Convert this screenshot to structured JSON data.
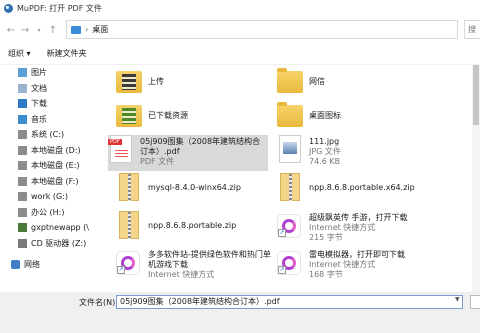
{
  "window": {
    "title": "MuPDF: 打开 PDF 文件"
  },
  "address": {
    "path": "桌面",
    "back_icon": "back-arrow-icon",
    "forward_icon": "forward-arrow-icon",
    "up_icon": "up-arrow-icon",
    "search_partial": "搜"
  },
  "toolbar": {
    "organize": "组织 ▾",
    "new_folder": "新建文件夹"
  },
  "sidebar": {
    "items": [
      {
        "label": "图片",
        "icon": "pictures-icon"
      },
      {
        "label": "文档",
        "icon": "documents-icon"
      },
      {
        "label": "下载",
        "icon": "downloads-icon"
      },
      {
        "label": "音乐",
        "icon": "music-icon"
      },
      {
        "label": "系统 (C:)",
        "icon": "drive-icon"
      },
      {
        "label": "本地磁盘 (D:)",
        "icon": "drive-icon"
      },
      {
        "label": "本地磁盘 (E:)",
        "icon": "drive-icon"
      },
      {
        "label": "本地磁盘 (F:)",
        "icon": "drive-icon"
      },
      {
        "label": "work (G:)",
        "icon": "drive-icon"
      },
      {
        "label": "办公 (H:)",
        "icon": "drive-icon"
      },
      {
        "label": "gxptnewapp (\\",
        "icon": "network-drive-icon"
      },
      {
        "label": "CD 驱动器 (Z:)",
        "icon": "cd-drive-icon"
      }
    ],
    "network": "网络"
  },
  "files": [
    {
      "name": "上传",
      "sub1": "",
      "sub2": "",
      "icon": "folder-upload-icon"
    },
    {
      "name": "网信",
      "sub1": "",
      "sub2": "",
      "icon": "folder-icon"
    },
    {
      "name": "已下载资源",
      "sub1": "",
      "sub2": "",
      "icon": "folder-download-icon"
    },
    {
      "name": "桌面图标",
      "sub1": "",
      "sub2": "",
      "icon": "folder-icon"
    },
    {
      "name": "05j909图集（2008年建筑结构合订本）.pdf",
      "sub1": "PDF 文件",
      "sub2": "",
      "icon": "pdf-file-icon"
    },
    {
      "name": "111.jpg",
      "sub1": "JPG 文件",
      "sub2": "74.6 KB",
      "icon": "jpg-file-icon"
    },
    {
      "name": "mysql-8.4.0-winx64.zip",
      "sub1": "",
      "sub2": "",
      "icon": "zip-file-icon"
    },
    {
      "name": "npp.8.6.8.portable.x64.zip",
      "sub1": "",
      "sub2": "",
      "icon": "zip-file-icon"
    },
    {
      "name": "npp.8.6.8.portable.zip",
      "sub1": "",
      "sub2": "",
      "icon": "zip-file-icon"
    },
    {
      "name": "超级飘英传 手游，打开下载",
      "sub1": "Internet 快捷方式",
      "sub2": "215 字节",
      "icon": "internet-shortcut-icon"
    },
    {
      "name": "多多软件站-提供绿色软件和热门单机游戏下载",
      "sub1": "Internet 快捷方式",
      "sub2": "",
      "icon": "internet-shortcut-icon"
    },
    {
      "name": "雷电模拟器，打开即可下载",
      "sub1": "Internet 快捷方式",
      "sub2": "168 字节",
      "icon": "internet-shortcut-icon"
    }
  ],
  "bottom": {
    "filename_label": "文件名(N):",
    "filename_value": "05j909图集（2008年建筑结构合订本）.pdf"
  }
}
